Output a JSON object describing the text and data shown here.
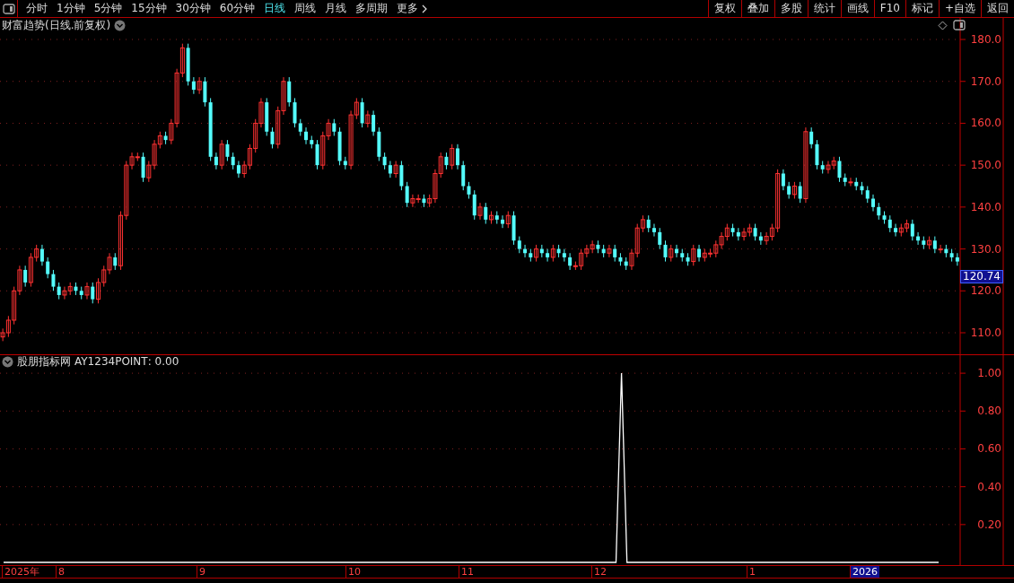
{
  "toolbar": {
    "periods": [
      {
        "label": "分时",
        "selected": false
      },
      {
        "label": "1分钟",
        "selected": false
      },
      {
        "label": "5分钟",
        "selected": false
      },
      {
        "label": "15分钟",
        "selected": false
      },
      {
        "label": "30分钟",
        "selected": false
      },
      {
        "label": "60分钟",
        "selected": false
      },
      {
        "label": "日线",
        "selected": true
      },
      {
        "label": "周线",
        "selected": false
      },
      {
        "label": "月线",
        "selected": false
      },
      {
        "label": "多周期",
        "selected": false
      },
      {
        "label": "更多",
        "selected": false
      }
    ],
    "actions": [
      "复权",
      "叠加",
      "多股",
      "统计",
      "画线",
      "F10",
      "标记",
      "+自选",
      "返回"
    ]
  },
  "price_panel": {
    "title": "财富趋势(日线.前复权)",
    "current_price": "120.74",
    "chart_data": {
      "type": "candlestick",
      "grid": true,
      "categories": [
        null,
        null,
        null,
        null,
        null,
        null,
        null,
        null,
        null,
        null,
        null,
        null,
        null,
        null,
        null,
        null,
        null,
        null,
        null,
        null,
        null,
        null,
        null,
        null,
        null,
        null,
        null,
        null,
        null,
        null,
        null,
        null,
        null,
        null,
        null,
        null,
        null,
        null,
        null,
        null,
        null,
        null,
        null,
        null,
        null,
        null,
        null,
        null,
        null,
        null,
        null,
        null,
        null,
        null,
        null,
        null,
        null,
        null,
        null,
        null,
        null,
        null,
        null,
        null,
        null,
        null,
        null,
        null,
        null,
        null,
        null,
        null,
        null,
        null,
        null,
        null,
        null,
        null,
        null,
        null,
        null,
        null,
        null,
        null,
        null,
        null,
        null,
        null,
        null,
        null,
        null,
        null,
        null,
        null,
        null,
        null,
        null,
        null,
        null,
        null,
        null,
        null,
        null,
        null,
        null,
        null,
        null,
        null,
        null,
        null,
        null,
        null,
        null,
        null,
        null,
        null,
        null,
        null,
        null,
        null,
        null,
        null,
        null,
        null,
        null,
        null,
        null,
        null,
        null,
        null,
        null,
        null,
        null,
        null,
        null,
        null,
        null,
        null,
        null,
        null,
        null,
        null,
        null,
        null,
        null,
        null,
        null,
        null,
        null,
        null,
        null,
        null,
        null,
        null,
        null,
        null,
        null,
        null,
        null,
        null,
        null,
        null,
        null,
        null,
        null,
        null,
        null,
        null,
        null,
        null,
        null
      ],
      "ylim": [
        104.86,
        185.14
      ],
      "yticks": [
        {
          "value": 180,
          "label": "180.0"
        },
        {
          "value": 170,
          "label": "170.0"
        },
        {
          "value": 160,
          "label": "160.0"
        },
        {
          "value": 150,
          "label": "150.0"
        },
        {
          "value": 140,
          "label": "140.0"
        },
        {
          "value": 130,
          "label": "130.0"
        },
        {
          "value": 120,
          "label": "120.0"
        },
        {
          "value": 110,
          "label": "110.0"
        }
      ],
      "ohlc": [
        [
          109,
          111,
          108,
          110
        ],
        [
          110,
          114,
          109,
          113
        ],
        [
          113,
          121,
          112,
          120
        ],
        [
          120,
          126,
          119,
          125
        ],
        [
          125,
          126,
          121,
          122
        ],
        [
          122,
          129,
          121,
          128
        ],
        [
          128,
          131,
          127,
          130
        ],
        [
          130,
          131,
          126,
          127
        ],
        [
          127,
          128,
          123,
          124
        ],
        [
          124,
          125,
          120,
          121
        ],
        [
          121,
          122,
          118,
          119
        ],
        [
          119,
          121,
          118,
          120
        ],
        [
          120,
          122,
          119,
          121
        ],
        [
          121,
          122,
          119,
          120
        ],
        [
          120,
          121,
          118,
          119
        ],
        [
          119,
          122,
          118,
          121
        ],
        [
          121,
          122,
          117,
          118
        ],
        [
          118,
          123,
          117,
          122
        ],
        [
          122,
          126,
          121,
          125
        ],
        [
          125,
          129,
          124,
          128
        ],
        [
          128,
          129,
          125,
          126
        ],
        [
          126,
          139,
          125,
          138
        ],
        [
          138,
          151,
          137,
          150
        ],
        [
          150,
          153,
          149,
          152
        ],
        [
          152,
          153,
          151,
          152
        ],
        [
          152,
          153,
          146,
          147
        ],
        [
          147,
          151,
          146,
          150
        ],
        [
          150,
          156,
          149,
          155
        ],
        [
          155,
          158,
          154,
          157
        ],
        [
          157,
          158,
          155,
          156
        ],
        [
          156,
          161,
          155,
          160
        ],
        [
          160,
          173,
          159,
          172
        ],
        [
          172,
          179,
          171,
          178
        ],
        [
          178,
          179,
          169,
          170
        ],
        [
          170,
          171,
          167,
          168
        ],
        [
          168,
          171,
          167,
          170
        ],
        [
          170,
          171,
          164,
          165
        ],
        [
          165,
          166,
          151,
          152
        ],
        [
          152,
          153,
          149,
          150
        ],
        [
          150,
          156,
          149,
          155
        ],
        [
          155,
          156,
          151,
          152
        ],
        [
          152,
          153,
          149,
          150
        ],
        [
          150,
          151,
          147,
          148
        ],
        [
          148,
          151,
          147,
          150
        ],
        [
          150,
          155,
          149,
          154
        ],
        [
          154,
          161,
          153,
          160
        ],
        [
          160,
          166,
          159,
          165
        ],
        [
          165,
          166,
          157,
          158
        ],
        [
          158,
          159,
          154,
          155
        ],
        [
          155,
          164,
          154,
          163
        ],
        [
          163,
          171,
          162,
          170
        ],
        [
          170,
          171,
          164,
          165
        ],
        [
          165,
          166,
          159,
          160
        ],
        [
          160,
          161,
          157,
          158
        ],
        [
          158,
          159,
          155,
          156
        ],
        [
          156,
          157,
          154,
          155
        ],
        [
          155,
          156,
          149,
          150
        ],
        [
          150,
          158,
          149,
          157
        ],
        [
          157,
          161,
          156,
          160
        ],
        [
          160,
          161,
          157,
          158
        ],
        [
          158,
          159,
          150,
          151
        ],
        [
          151,
          152,
          149,
          150
        ],
        [
          150,
          163,
          149,
          162
        ],
        [
          162,
          166,
          161,
          165
        ],
        [
          165,
          166,
          159,
          160
        ],
        [
          160,
          163,
          159,
          162
        ],
        [
          162,
          163,
          157,
          158
        ],
        [
          158,
          159,
          151,
          152
        ],
        [
          152,
          153,
          149,
          150
        ],
        [
          150,
          151,
          147,
          148
        ],
        [
          148,
          151,
          147,
          150
        ],
        [
          150,
          151,
          144,
          145
        ],
        [
          145,
          146,
          140,
          141
        ],
        [
          141,
          143,
          140,
          142
        ],
        [
          142,
          143,
          141,
          142
        ],
        [
          142,
          143,
          140,
          141
        ],
        [
          141,
          143,
          140,
          142
        ],
        [
          142,
          149,
          141,
          148
        ],
        [
          148,
          153,
          147,
          152
        ],
        [
          152,
          153,
          149,
          150
        ],
        [
          150,
          155,
          149,
          154
        ],
        [
          154,
          155,
          149,
          150
        ],
        [
          150,
          151,
          144,
          145
        ],
        [
          145,
          146,
          142,
          143
        ],
        [
          143,
          144,
          137,
          138
        ],
        [
          138,
          141,
          137,
          140
        ],
        [
          140,
          141,
          136,
          137
        ],
        [
          137,
          139,
          136,
          138
        ],
        [
          138,
          139,
          136,
          137
        ],
        [
          137,
          138,
          135,
          136
        ],
        [
          136,
          139,
          135,
          138
        ],
        [
          138,
          139,
          131,
          132
        ],
        [
          132,
          133,
          129,
          130
        ],
        [
          130,
          131,
          128,
          129
        ],
        [
          129,
          130,
          127,
          128
        ],
        [
          128,
          131,
          127,
          130
        ],
        [
          130,
          131,
          128,
          129
        ],
        [
          129,
          130,
          127,
          128
        ],
        [
          128,
          131,
          127,
          130
        ],
        [
          130,
          131,
          128,
          129
        ],
        [
          129,
          130,
          127,
          128
        ],
        [
          128,
          129,
          125,
          126
        ],
        [
          126,
          127,
          125,
          126
        ],
        [
          126,
          130,
          125,
          129
        ],
        [
          129,
          131,
          128,
          130
        ],
        [
          130,
          132,
          129,
          131
        ],
        [
          131,
          132,
          129,
          130
        ],
        [
          130,
          131,
          128,
          129
        ],
        [
          129,
          131,
          128,
          130
        ],
        [
          130,
          131,
          127,
          128
        ],
        [
          128,
          129,
          126,
          127
        ],
        [
          127,
          128,
          125,
          126
        ],
        [
          126,
          130,
          125,
          129
        ],
        [
          129,
          136,
          128,
          135
        ],
        [
          135,
          138,
          134,
          137
        ],
        [
          137,
          138,
          134,
          135
        ],
        [
          135,
          136,
          133,
          134
        ],
        [
          134,
          135,
          130,
          131
        ],
        [
          131,
          132,
          127,
          128
        ],
        [
          128,
          131,
          127,
          130
        ],
        [
          130,
          131,
          128,
          129
        ],
        [
          129,
          130,
          127,
          128
        ],
        [
          128,
          129,
          126,
          127
        ],
        [
          127,
          131,
          126,
          130
        ],
        [
          130,
          131,
          127,
          128
        ],
        [
          128,
          130,
          127,
          129
        ],
        [
          129,
          130,
          128,
          129
        ],
        [
          129,
          132,
          128,
          131
        ],
        [
          131,
          134,
          130,
          133
        ],
        [
          133,
          136,
          132,
          135
        ],
        [
          135,
          136,
          133,
          134
        ],
        [
          134,
          135,
          132,
          133
        ],
        [
          133,
          135,
          132,
          134
        ],
        [
          134,
          136,
          133,
          135
        ],
        [
          135,
          136,
          132,
          133
        ],
        [
          133,
          134,
          131,
          132
        ],
        [
          132,
          134,
          131,
          133
        ],
        [
          133,
          136,
          132,
          135
        ],
        [
          135,
          149,
          134,
          148
        ],
        [
          148,
          149,
          144,
          145
        ],
        [
          145,
          146,
          142,
          143
        ],
        [
          143,
          146,
          142,
          145
        ],
        [
          145,
          146,
          141,
          142
        ],
        [
          142,
          159,
          141,
          158
        ],
        [
          158,
          159,
          154,
          155
        ],
        [
          155,
          156,
          149,
          150
        ],
        [
          150,
          151,
          148,
          149
        ],
        [
          149,
          151,
          148,
          150
        ],
        [
          150,
          152,
          149,
          151
        ],
        [
          151,
          152,
          146,
          147
        ],
        [
          147,
          148,
          145,
          146
        ],
        [
          146,
          147,
          145,
          146
        ],
        [
          146,
          147,
          144,
          145
        ],
        [
          145,
          146,
          143,
          144
        ],
        [
          144,
          145,
          141,
          142
        ],
        [
          142,
          143,
          139,
          140
        ],
        [
          140,
          141,
          137,
          138
        ],
        [
          138,
          139,
          136,
          137
        ],
        [
          137,
          138,
          134,
          135
        ],
        [
          135,
          136,
          133,
          134
        ],
        [
          134,
          136,
          133,
          135
        ],
        [
          135,
          137,
          134,
          136
        ],
        [
          136,
          137,
          132,
          133
        ],
        [
          133,
          134,
          131,
          132
        ],
        [
          132,
          133,
          130,
          131
        ],
        [
          131,
          133,
          130,
          132
        ],
        [
          132,
          133,
          129,
          130
        ],
        [
          130,
          131,
          129,
          130
        ],
        [
          130,
          131,
          128,
          129
        ],
        [
          129,
          130,
          127,
          128
        ],
        [
          128,
          129,
          126,
          127
        ]
      ]
    }
  },
  "indicator_panel": {
    "source": "股朋指标网",
    "reading": ": 0.00",
    "chart_data": {
      "type": "line",
      "grid": true,
      "ylim": [
        -0.014,
        1.1
      ],
      "yticks": [
        {
          "value": 0.2,
          "label": "0.20"
        },
        {
          "value": 0.4,
          "label": "0.40"
        },
        {
          "value": 0.6,
          "label": "0.60"
        },
        {
          "value": 0.8,
          "label": "0.80"
        },
        {
          "value": 1.0,
          "label": "1.00"
        }
      ],
      "series": [
        {
          "name": "AY1234POINT",
          "color": "#ffffff",
          "values": [
            0,
            0,
            0,
            0,
            0,
            0,
            0,
            0,
            0,
            0,
            0,
            0,
            0,
            0,
            0,
            0,
            0,
            0,
            0,
            0,
            0,
            0,
            0,
            0,
            0,
            0,
            0,
            0,
            0,
            0,
            0,
            0,
            0,
            0,
            0,
            0,
            0,
            0,
            0,
            0,
            0,
            0,
            0,
            0,
            0,
            0,
            0,
            0,
            0,
            0,
            0,
            0,
            0,
            0,
            0,
            0,
            0,
            0,
            0,
            0,
            0,
            0,
            0,
            0,
            0,
            0,
            0,
            0,
            0,
            0,
            0,
            0,
            0,
            0,
            0,
            0,
            0,
            0,
            0,
            0,
            0,
            0,
            0,
            0,
            0,
            0,
            0,
            0,
            0,
            0,
            0,
            0,
            0,
            0,
            0,
            0,
            0,
            0,
            0,
            0,
            0,
            0,
            0,
            0,
            0,
            0,
            0,
            0,
            0,
            0,
            0,
            0,
            0,
            1,
            0,
            0,
            0,
            0,
            0,
            0,
            0,
            0,
            0,
            0,
            0,
            0,
            0,
            0,
            0,
            0,
            0,
            0,
            0,
            0,
            0,
            0,
            0,
            0,
            0,
            0,
            0,
            0,
            0,
            0,
            0,
            0,
            0,
            0,
            0,
            0,
            0,
            0,
            0,
            0,
            0,
            0,
            0,
            0,
            0,
            0,
            0,
            0,
            0,
            0,
            0,
            0,
            0,
            0,
            0,
            0,
            0,
            0
          ]
        }
      ]
    }
  },
  "timeline": [
    {
      "label": "2025年",
      "highlighted": false
    },
    {
      "label": "8",
      "highlighted": false
    },
    {
      "label": "9",
      "highlighted": false
    },
    {
      "label": "10",
      "highlighted": false
    },
    {
      "label": "11",
      "highlighted": false
    },
    {
      "label": "12",
      "highlighted": false
    },
    {
      "label": "1",
      "highlighted": false
    },
    {
      "label": "2026",
      "highlighted": true
    }
  ]
}
